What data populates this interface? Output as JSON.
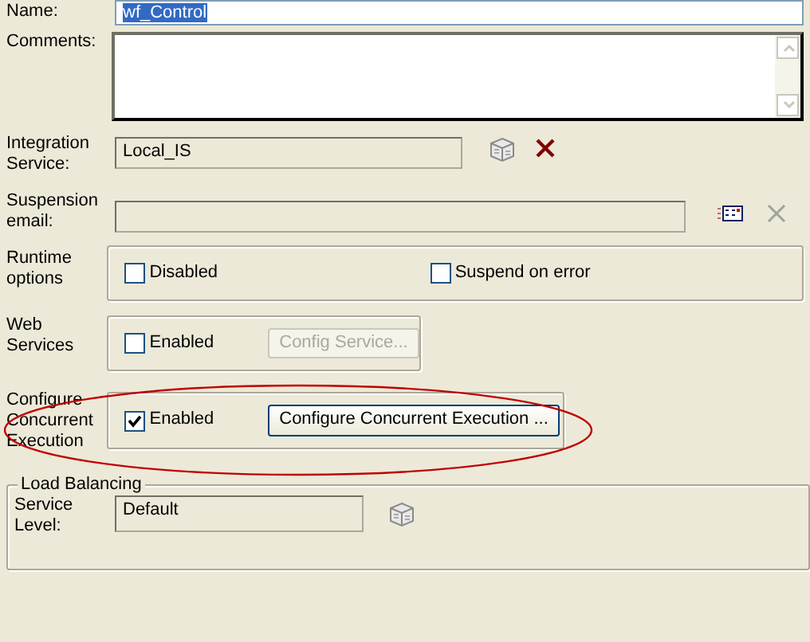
{
  "name": {
    "label": "Name:",
    "value": "wf_Control",
    "selected": true
  },
  "comments": {
    "label": "Comments:"
  },
  "integration_service": {
    "label": "Integration Service:",
    "value": "Local_IS",
    "disabled": true,
    "clear_disabled": false
  },
  "suspension_email": {
    "label": "Suspension email:",
    "disabled": true,
    "clear_disabled": true
  },
  "runtime_options": {
    "label": "Runtime options",
    "options": [
      {
        "label": "Disabled",
        "checked": false
      },
      {
        "label": "Suspend on error",
        "checked": false
      }
    ]
  },
  "web_services": {
    "label": "Web Services",
    "option": {
      "label": "Enabled",
      "checked": false
    },
    "button": {
      "label": "Config Service...",
      "disabled": true
    }
  },
  "concurrent_execution": {
    "label": "Configure Concurrent Execution",
    "option": {
      "label": "Enabled",
      "checked": true
    },
    "button": {
      "label": "Configure Concurrent Execution ...",
      "disabled": false
    },
    "highlighted": true
  },
  "load_balancing": {
    "title": "Load Balancing",
    "label": "Service Level:",
    "value": "Default",
    "disabled": true
  }
}
